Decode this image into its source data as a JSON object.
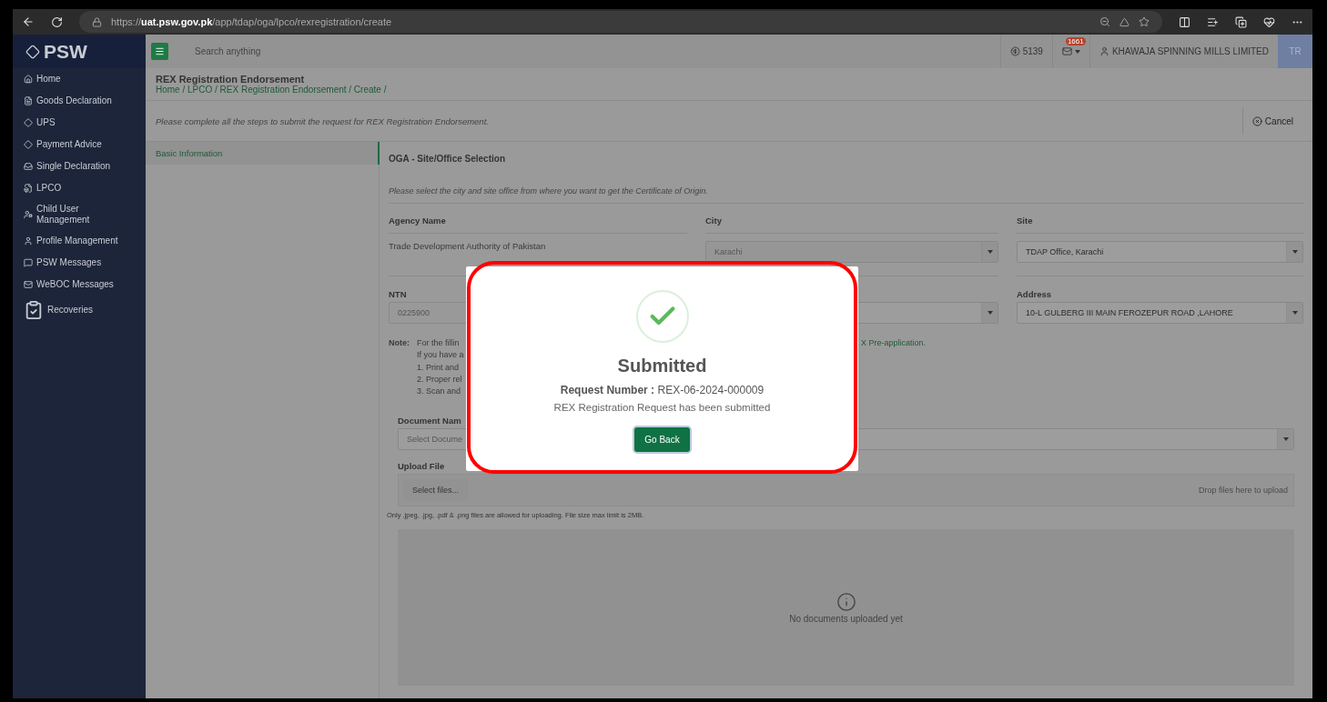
{
  "browser": {
    "url": "https://**uat.psw.gov.pk**/app/tdap/oga/lpco/rexregistration/create"
  },
  "sidebar": {
    "logo": "PSW",
    "items": [
      {
        "label": "Home"
      },
      {
        "label": "Goods Declaration"
      },
      {
        "label": "UPS"
      },
      {
        "label": "Payment Advice"
      },
      {
        "label": "Single Declaration"
      },
      {
        "label": "LPCO"
      },
      {
        "label": "Child User Management"
      },
      {
        "label": "Profile Management"
      },
      {
        "label": "PSW Messages"
      },
      {
        "label": "WeBOC Messages"
      },
      {
        "label": "Recoveries"
      }
    ]
  },
  "topbar": {
    "search_placeholder": "Search anything",
    "coins": "5139",
    "mail_badge": "1661",
    "user": "KHAWAJA SPINNING MILLS LIMITED",
    "initials": "TR"
  },
  "header": {
    "title": "REX Registration Endorsement",
    "breadcrumb": "Home / LPCO / REX Registration Endorsement / Create /",
    "instruction": "Please complete all the steps to submit the request for REX Registration Endorsement.",
    "cancel": "Cancel"
  },
  "steps": [
    {
      "label": "Basic Information",
      "selected": true
    }
  ],
  "section": {
    "title": "OGA - Site/Office Selection",
    "hint": "Please select the city and site office from where you want to get the Certificate of Origin.",
    "columns": [
      "Agency Name",
      "City",
      "Site"
    ],
    "agency": "Trade Development Authority of Pakistan",
    "city": {
      "value": "Karachi",
      "disabled": true
    },
    "site": {
      "value": "TDAP Office, Karachi",
      "disabled": false
    },
    "ntn_label": "NTN",
    "ntn": "0225900",
    "address_label": "Address",
    "address": "10-L GULBERG III MAIN FEROZEPUR ROAD  ,LAHORE"
  },
  "note": {
    "label": "Note:",
    "lines": [
      "For the fillin",
      "If you have a"
    ],
    "link_tail": "X Pre-application.",
    "steps": [
      "1. Print and",
      "2. Proper rel",
      "3. Scan and"
    ]
  },
  "document": {
    "label": "Document Nam",
    "placeholder": "Select Docume"
  },
  "upload": {
    "label": "Upload File",
    "button": "Select files...",
    "drop": "Drop files here to upload",
    "rule": "Only .jpeg, .jpg, .pdf & .png files are allowed for uploading. File size max limit is 2MB.",
    "empty": "No documents uploaded yet"
  },
  "modal": {
    "title": "Submitted",
    "request_label": "Request Number :",
    "request_number": "REX-06-2024-000009",
    "message": "REX Registration Request has been submitted",
    "button": "Go Back"
  }
}
